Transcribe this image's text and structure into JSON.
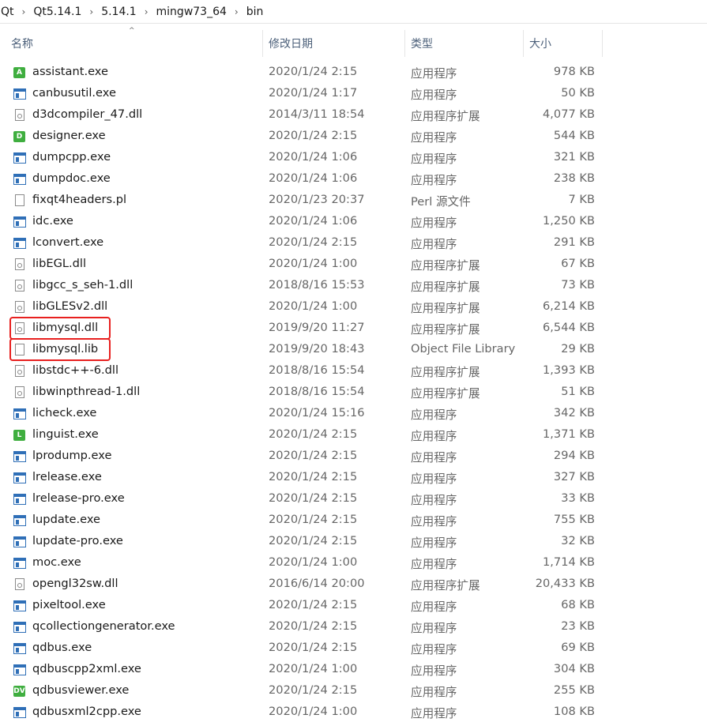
{
  "breadcrumb": [
    "Qt",
    "Qt5.14.1",
    "5.14.1",
    "mingw73_64",
    "bin"
  ],
  "columns": {
    "name": "名称",
    "date": "修改日期",
    "type": "类型",
    "size": "大小"
  },
  "files": [
    {
      "name": "assistant.exe",
      "date": "2020/1/24 2:15",
      "type": "应用程序",
      "size": "978 KB",
      "icon": "assistant-app-icon",
      "badge": "A"
    },
    {
      "name": "canbusutil.exe",
      "date": "2020/1/24 1:17",
      "type": "应用程序",
      "size": "50 KB",
      "icon": "exe-icon"
    },
    {
      "name": "d3dcompiler_47.dll",
      "date": "2014/3/11 18:54",
      "type": "应用程序扩展",
      "size": "4,077 KB",
      "icon": "dll-icon"
    },
    {
      "name": "designer.exe",
      "date": "2020/1/24 2:15",
      "type": "应用程序",
      "size": "544 KB",
      "icon": "designer-app-icon",
      "badge": "D"
    },
    {
      "name": "dumpcpp.exe",
      "date": "2020/1/24 1:06",
      "type": "应用程序",
      "size": "321 KB",
      "icon": "exe-icon"
    },
    {
      "name": "dumpdoc.exe",
      "date": "2020/1/24 1:06",
      "type": "应用程序",
      "size": "238 KB",
      "icon": "exe-icon"
    },
    {
      "name": "fixqt4headers.pl",
      "date": "2020/1/23 20:37",
      "type": "Perl 源文件",
      "size": "7 KB",
      "icon": "file-icon"
    },
    {
      "name": "idc.exe",
      "date": "2020/1/24 1:06",
      "type": "应用程序",
      "size": "1,250 KB",
      "icon": "exe-icon"
    },
    {
      "name": "lconvert.exe",
      "date": "2020/1/24 2:15",
      "type": "应用程序",
      "size": "291 KB",
      "icon": "exe-icon"
    },
    {
      "name": "libEGL.dll",
      "date": "2020/1/24 1:00",
      "type": "应用程序扩展",
      "size": "67 KB",
      "icon": "dll-icon"
    },
    {
      "name": "libgcc_s_seh-1.dll",
      "date": "2018/8/16 15:53",
      "type": "应用程序扩展",
      "size": "73 KB",
      "icon": "dll-icon"
    },
    {
      "name": "libGLESv2.dll",
      "date": "2020/1/24 1:00",
      "type": "应用程序扩展",
      "size": "6,214 KB",
      "icon": "dll-icon"
    },
    {
      "name": "libmysql.dll",
      "date": "2019/9/20 11:27",
      "type": "应用程序扩展",
      "size": "6,544 KB",
      "icon": "dll-icon",
      "highlight": true
    },
    {
      "name": "libmysql.lib",
      "date": "2019/9/20 18:43",
      "type": "Object File Library",
      "size": "29 KB",
      "icon": "file-icon",
      "highlight": true
    },
    {
      "name": "libstdc++-6.dll",
      "date": "2018/8/16 15:54",
      "type": "应用程序扩展",
      "size": "1,393 KB",
      "icon": "dll-icon"
    },
    {
      "name": "libwinpthread-1.dll",
      "date": "2018/8/16 15:54",
      "type": "应用程序扩展",
      "size": "51 KB",
      "icon": "dll-icon"
    },
    {
      "name": "licheck.exe",
      "date": "2020/1/24 15:16",
      "type": "应用程序",
      "size": "342 KB",
      "icon": "exe-icon"
    },
    {
      "name": "linguist.exe",
      "date": "2020/1/24 2:15",
      "type": "应用程序",
      "size": "1,371 KB",
      "icon": "linguist-app-icon",
      "badge": "L"
    },
    {
      "name": "lprodump.exe",
      "date": "2020/1/24 2:15",
      "type": "应用程序",
      "size": "294 KB",
      "icon": "exe-icon"
    },
    {
      "name": "lrelease.exe",
      "date": "2020/1/24 2:15",
      "type": "应用程序",
      "size": "327 KB",
      "icon": "exe-icon"
    },
    {
      "name": "lrelease-pro.exe",
      "date": "2020/1/24 2:15",
      "type": "应用程序",
      "size": "33 KB",
      "icon": "exe-icon"
    },
    {
      "name": "lupdate.exe",
      "date": "2020/1/24 2:15",
      "type": "应用程序",
      "size": "755 KB",
      "icon": "exe-icon"
    },
    {
      "name": "lupdate-pro.exe",
      "date": "2020/1/24 2:15",
      "type": "应用程序",
      "size": "32 KB",
      "icon": "exe-icon"
    },
    {
      "name": "moc.exe",
      "date": "2020/1/24 1:00",
      "type": "应用程序",
      "size": "1,714 KB",
      "icon": "exe-icon"
    },
    {
      "name": "opengl32sw.dll",
      "date": "2016/6/14 20:00",
      "type": "应用程序扩展",
      "size": "20,433 KB",
      "icon": "dll-icon"
    },
    {
      "name": "pixeltool.exe",
      "date": "2020/1/24 2:15",
      "type": "应用程序",
      "size": "68 KB",
      "icon": "exe-icon"
    },
    {
      "name": "qcollectiongenerator.exe",
      "date": "2020/1/24 2:15",
      "type": "应用程序",
      "size": "23 KB",
      "icon": "exe-icon"
    },
    {
      "name": "qdbus.exe",
      "date": "2020/1/24 2:15",
      "type": "应用程序",
      "size": "69 KB",
      "icon": "exe-icon"
    },
    {
      "name": "qdbuscpp2xml.exe",
      "date": "2020/1/24 1:00",
      "type": "应用程序",
      "size": "304 KB",
      "icon": "exe-icon"
    },
    {
      "name": "qdbusviewer.exe",
      "date": "2020/1/24 2:15",
      "type": "应用程序",
      "size": "255 KB",
      "icon": "dbusviewer-app-icon",
      "badge": "DV"
    },
    {
      "name": "qdbusxml2cpp.exe",
      "date": "2020/1/24 1:00",
      "type": "应用程序",
      "size": "108 KB",
      "icon": "exe-icon"
    }
  ]
}
